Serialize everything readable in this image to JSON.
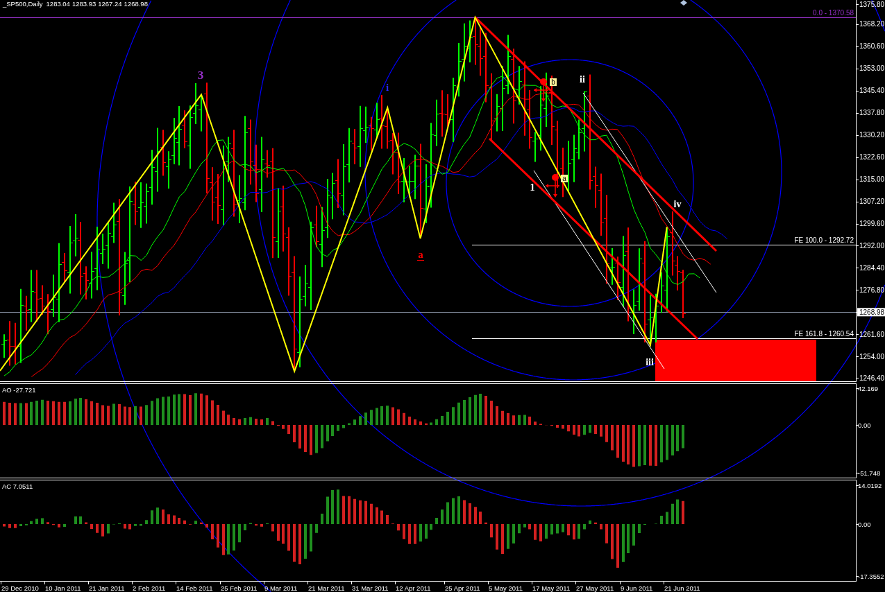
{
  "header": {
    "symbol": "_SP500,Daily",
    "ohlc": [
      "1283.04",
      "1283.93",
      "1267.24",
      "1268.98"
    ]
  },
  "price_panel": {
    "levels": [
      {
        "kind": "retracement",
        "label": "0.0 - 1370.58",
        "color": "#9932cc"
      },
      {
        "kind": "expansion",
        "label": "FE 100.0 - 1292.72",
        "color": "#ffffff"
      },
      {
        "kind": "expansion",
        "label": "FE 161.8 - 1260.54",
        "color": "#ffffff"
      }
    ],
    "wave_labels": [
      {
        "text": "3",
        "color": "#9932cc",
        "underlined": false
      },
      {
        "text": "i",
        "color": "#2a2aff",
        "underlined": false
      },
      {
        "text": "a",
        "color": "#ff0000",
        "underlined": true
      },
      {
        "text": "1",
        "color": "#ffffff",
        "underlined": false
      },
      {
        "text": "ii",
        "color": "#ffffff",
        "underlined": false
      },
      {
        "text": "iii",
        "color": "#ffffff",
        "underlined": false
      },
      {
        "text": "iv",
        "color": "#ffffff",
        "underlined": false
      }
    ],
    "markers": [
      {
        "label": "b"
      },
      {
        "label": "a"
      }
    ],
    "axis": [
      {
        "kind": "tick",
        "text": "1375.80"
      },
      {
        "kind": "tick",
        "text": "1368.20"
      },
      {
        "kind": "tick",
        "text": "1360.60"
      },
      {
        "kind": "tick",
        "text": "1353.00"
      },
      {
        "kind": "tick",
        "text": "1345.40"
      },
      {
        "kind": "tick",
        "text": "1337.80"
      },
      {
        "kind": "tick",
        "text": "1330.20"
      },
      {
        "kind": "tick",
        "text": "1322.60"
      },
      {
        "kind": "tick",
        "text": "1315.00"
      },
      {
        "kind": "tick",
        "text": "1307.20"
      },
      {
        "kind": "tick",
        "text": "1299.60"
      },
      {
        "kind": "tick",
        "text": "1292.00"
      },
      {
        "kind": "tick",
        "text": "1284.40"
      },
      {
        "kind": "tick",
        "text": "1276.80"
      },
      {
        "kind": "current",
        "text": "1268.98"
      },
      {
        "kind": "tick",
        "text": "1261.60"
      },
      {
        "kind": "tick",
        "text": "1254.00"
      },
      {
        "kind": "tick",
        "text": "1246.40"
      }
    ]
  },
  "indicators": [
    {
      "kind": "ao",
      "title": "AO -27.721",
      "axis": [
        "42.169",
        "0.00",
        "-51.748"
      ]
    },
    {
      "kind": "ac",
      "title": "AC 7.0511",
      "axis": [
        "14.0192",
        "0.00",
        "-17.3552"
      ]
    }
  ],
  "time_axis": [
    "29 Dec 2010",
    "10 Jan 2011",
    "21 Jan 2011",
    "2 Feb 2011",
    "14 Feb 2011",
    "25 Feb 2011",
    "9 Mar 2011",
    "21 Mar 2011",
    "31 Mar 2011",
    "12 Apr 2011",
    "25 Apr 2011",
    "5 May 2011",
    "17 May 2011",
    "27 May 2011",
    "9 Jun 2011",
    "21 Jun 2011"
  ]
}
